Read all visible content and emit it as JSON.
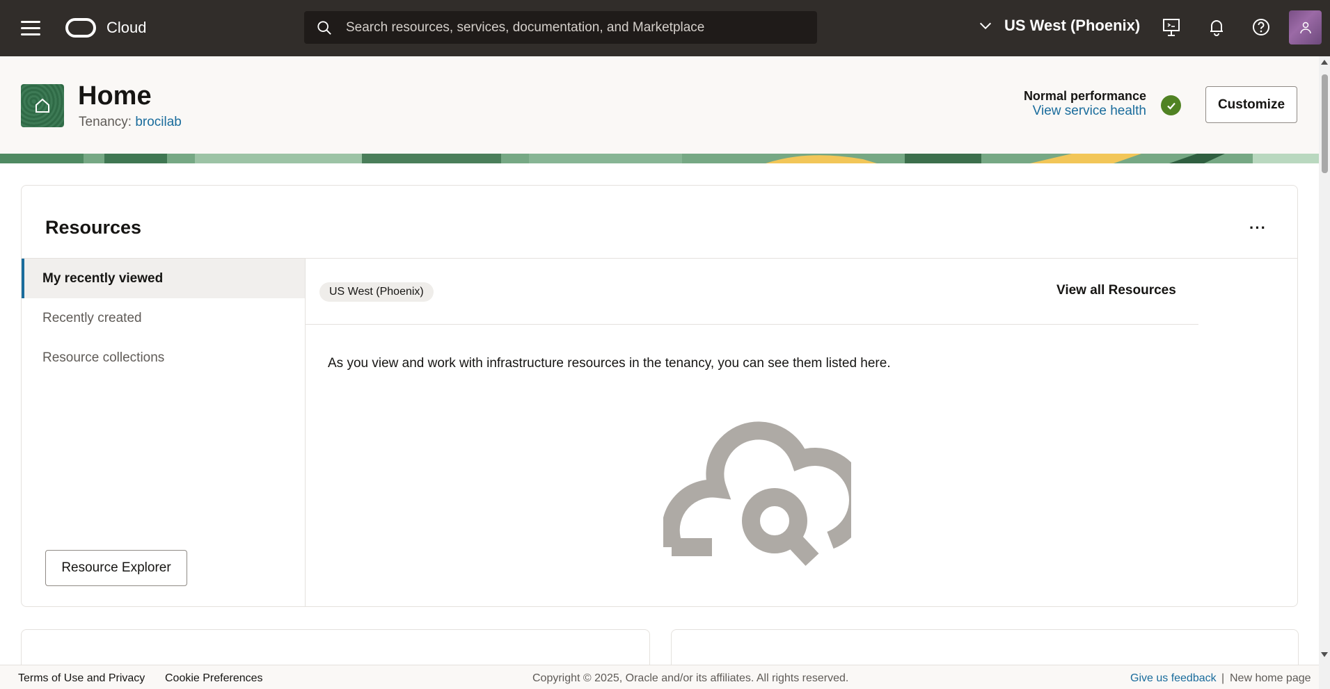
{
  "topbar": {
    "brand": "Cloud",
    "search_placeholder": "Search resources, services, documentation, and Marketplace",
    "region": "US West (Phoenix)",
    "icons": [
      "menu-icon",
      "oracle-logo-icon",
      "search-icon",
      "chevron-down-icon",
      "developer-tools-icon",
      "bell-icon",
      "help-icon",
      "user-icon"
    ]
  },
  "header": {
    "title": "Home",
    "tenancy_label": "Tenancy:",
    "tenancy_name": "brocilab",
    "performance_status": "Normal performance",
    "service_health_link": "View service health",
    "customize_label": "Customize"
  },
  "resources": {
    "title": "Resources",
    "more_label": "···",
    "tabs": [
      {
        "label": "My recently viewed",
        "active": true
      },
      {
        "label": "Recently created",
        "active": false
      },
      {
        "label": "Resource collections",
        "active": false
      }
    ],
    "explorer_label": "Resource Explorer",
    "region_chip": "US West (Phoenix)",
    "view_all_label": "View all Resources",
    "empty_message": "As you view and work with infrastructure resources in the tenancy, you can see them listed here."
  },
  "footer": {
    "terms": "Terms of Use and Privacy",
    "cookies": "Cookie Preferences",
    "copyright": "Copyright © 2025, Oracle and/or its affiliates. All rights reserved.",
    "feedback": "Give us feedback",
    "separator": "|",
    "new_home": "New home page"
  },
  "colors": {
    "topbar_bg": "#312d2a",
    "link": "#1a6c9c",
    "success": "#508223",
    "active_tab_border": "#1a6c9c"
  }
}
